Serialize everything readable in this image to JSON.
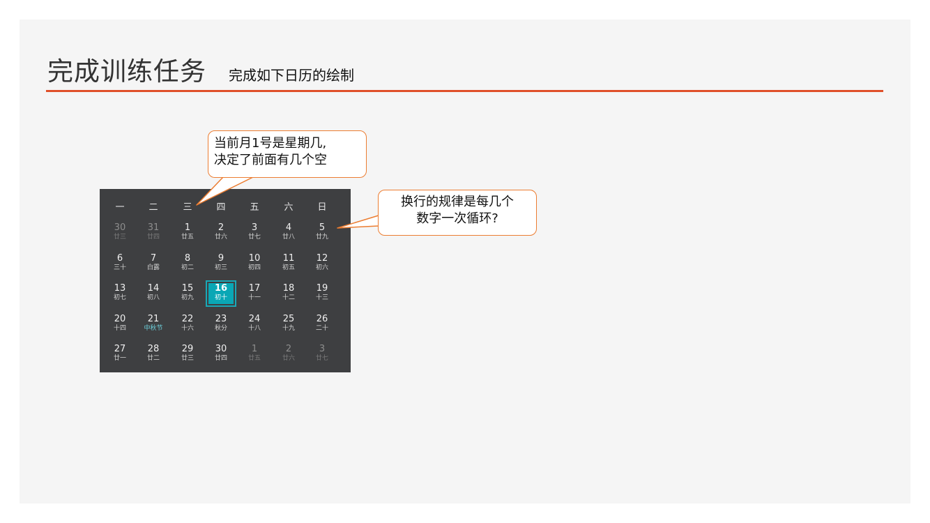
{
  "slide": {
    "title": "完成训练任务",
    "subtitle": "完成如下日历的绘制",
    "accent_color": "#e0502a"
  },
  "calendar": {
    "weekdays": [
      "一",
      "二",
      "三",
      "四",
      "五",
      "六",
      "日"
    ],
    "weeks": [
      [
        {
          "day": "30",
          "lunar": "廿三",
          "dim": true
        },
        {
          "day": "31",
          "lunar": "廿四",
          "dim": true
        },
        {
          "day": "1",
          "lunar": "廿五"
        },
        {
          "day": "2",
          "lunar": "廿六"
        },
        {
          "day": "3",
          "lunar": "廿七"
        },
        {
          "day": "4",
          "lunar": "廿八"
        },
        {
          "day": "5",
          "lunar": "廿九"
        }
      ],
      [
        {
          "day": "6",
          "lunar": "三十"
        },
        {
          "day": "7",
          "lunar": "白露"
        },
        {
          "day": "8",
          "lunar": "初二"
        },
        {
          "day": "9",
          "lunar": "初三"
        },
        {
          "day": "10",
          "lunar": "初四"
        },
        {
          "day": "11",
          "lunar": "初五"
        },
        {
          "day": "12",
          "lunar": "初六"
        }
      ],
      [
        {
          "day": "13",
          "lunar": "初七"
        },
        {
          "day": "14",
          "lunar": "初八"
        },
        {
          "day": "15",
          "lunar": "初九"
        },
        {
          "day": "16",
          "lunar": "初十",
          "today": true
        },
        {
          "day": "17",
          "lunar": "十一"
        },
        {
          "day": "18",
          "lunar": "十二"
        },
        {
          "day": "19",
          "lunar": "十三"
        }
      ],
      [
        {
          "day": "20",
          "lunar": "十四"
        },
        {
          "day": "21",
          "lunar": "中秋节",
          "festival": true
        },
        {
          "day": "22",
          "lunar": "十六"
        },
        {
          "day": "23",
          "lunar": "秋分"
        },
        {
          "day": "24",
          "lunar": "十八"
        },
        {
          "day": "25",
          "lunar": "十九"
        },
        {
          "day": "26",
          "lunar": "二十"
        }
      ],
      [
        {
          "day": "27",
          "lunar": "廿一"
        },
        {
          "day": "28",
          "lunar": "廿二"
        },
        {
          "day": "29",
          "lunar": "廿三"
        },
        {
          "day": "30",
          "lunar": "廿四"
        },
        {
          "day": "1",
          "lunar": "廿五",
          "dim": true
        },
        {
          "day": "2",
          "lunar": "廿六",
          "dim": true
        },
        {
          "day": "3",
          "lunar": "廿七",
          "dim": true
        }
      ]
    ],
    "colors": {
      "background": "#3e3f41",
      "today": "#0aa7b5",
      "festival": "#6dd0dc"
    }
  },
  "callouts": {
    "first": {
      "line1": "当前月1号是星期几,",
      "line2": "决定了前面有几个空"
    },
    "second": {
      "line1": "换行的规律是每几个",
      "line2": "数字一次循环?"
    },
    "border_color": "#ec7d31"
  }
}
